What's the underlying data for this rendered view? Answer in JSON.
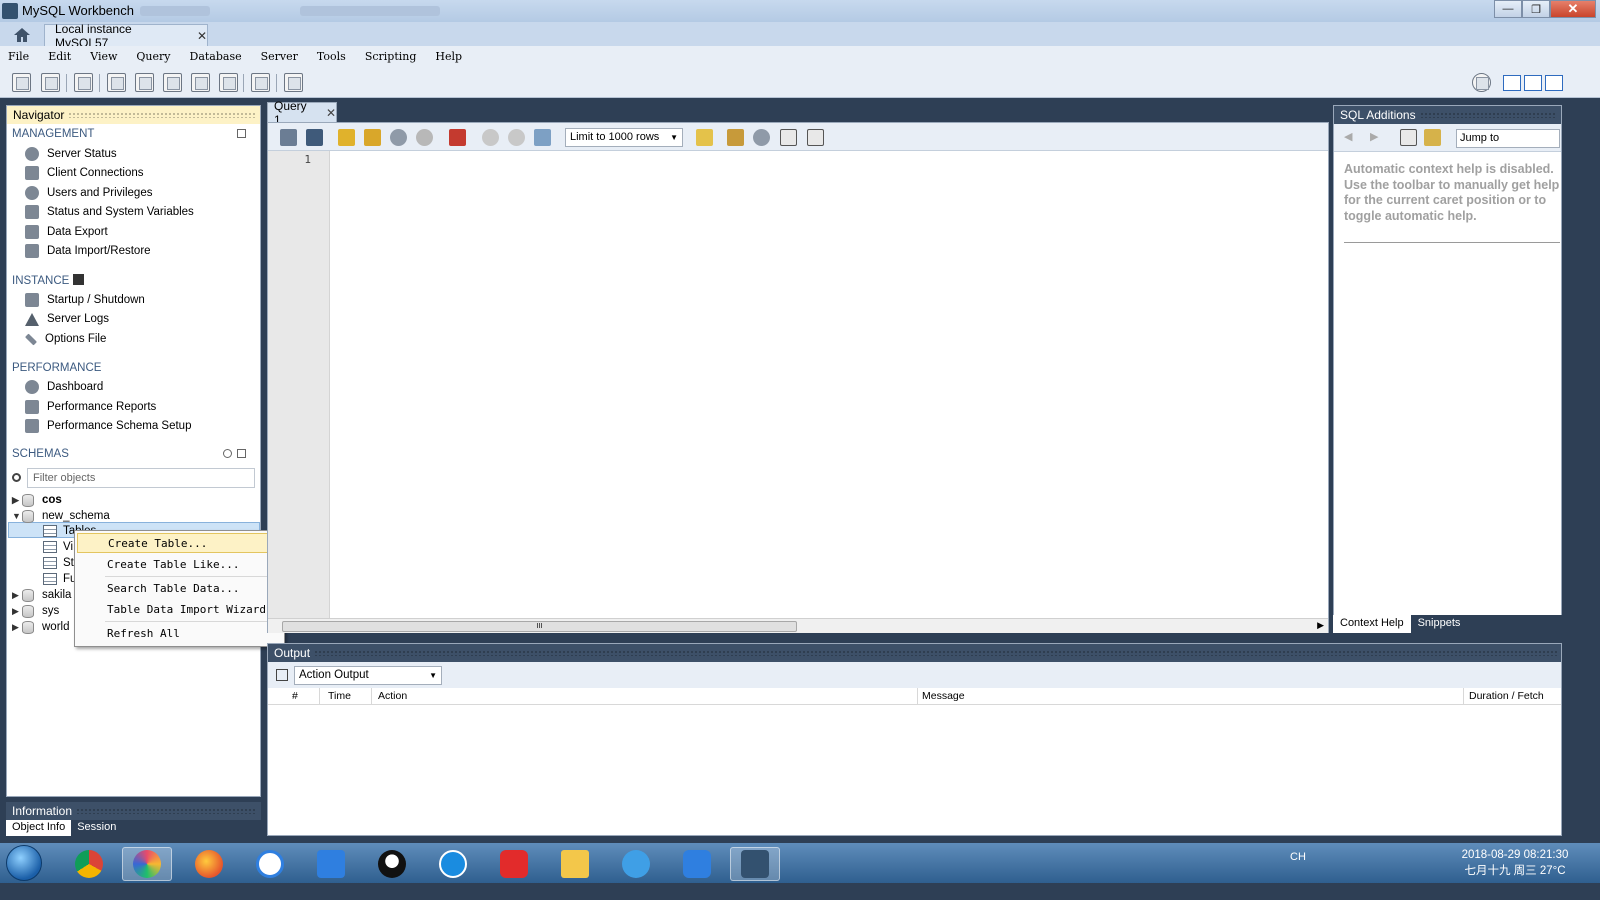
{
  "window": {
    "title": "MySQL Workbench",
    "connection_tab": "Local instance MySQL57"
  },
  "menu": [
    "File",
    "Edit",
    "View",
    "Query",
    "Database",
    "Server",
    "Tools",
    "Scripting",
    "Help"
  ],
  "navigator": {
    "header": "Navigator",
    "management": {
      "title": "MANAGEMENT",
      "items": [
        {
          "label": "Server Status",
          "icon": "server-status-icon"
        },
        {
          "label": "Client Connections",
          "icon": "client-connections-icon"
        },
        {
          "label": "Users and Privileges",
          "icon": "users-icon"
        },
        {
          "label": "Status and System Variables",
          "icon": "variables-icon"
        },
        {
          "label": "Data Export",
          "icon": "export-icon"
        },
        {
          "label": "Data Import/Restore",
          "icon": "import-icon"
        }
      ]
    },
    "instance": {
      "title": "INSTANCE",
      "items": [
        {
          "label": "Startup / Shutdown",
          "icon": "startup-icon"
        },
        {
          "label": "Server Logs",
          "icon": "warning-icon"
        },
        {
          "label": "Options File",
          "icon": "wrench-icon"
        }
      ]
    },
    "performance": {
      "title": "PERFORMANCE",
      "items": [
        {
          "label": "Dashboard",
          "icon": "dashboard-icon"
        },
        {
          "label": "Performance Reports",
          "icon": "reports-icon"
        },
        {
          "label": "Performance Schema Setup",
          "icon": "schema-setup-icon"
        }
      ]
    },
    "schemas": {
      "title": "SCHEMAS",
      "filter_placeholder": "Filter objects",
      "tree": [
        {
          "label": "cos",
          "bold": true,
          "expanded": false
        },
        {
          "label": "new_schema",
          "expanded": true
        },
        {
          "label": "Tables",
          "child": true
        },
        {
          "label": "Vi",
          "child": true
        },
        {
          "label": "St",
          "child": true
        },
        {
          "label": "Fu",
          "child": true
        },
        {
          "label": "sakila",
          "expanded": false
        },
        {
          "label": "sys",
          "expanded": false
        },
        {
          "label": "world",
          "expanded": false
        }
      ]
    }
  },
  "context_menu": {
    "items": [
      "Create Table...",
      "Create Table Like...",
      "Search Table Data...",
      "Table Data Import Wizard",
      "Refresh All"
    ]
  },
  "information": {
    "header": "Information",
    "tabs": [
      "Object Info",
      "Session"
    ]
  },
  "query": {
    "tab_label": "Query 1",
    "limit_label": "Limit to 1000 rows",
    "line_number": "1",
    "scroll_grip": "III"
  },
  "sql_additions": {
    "header": "SQL Additions",
    "jump_to": "Jump to",
    "help_text": "Automatic context help is disabled. Use the toolbar to manually get help for the current caret position or to toggle automatic help.",
    "tabs": [
      "Context Help",
      "Snippets"
    ]
  },
  "output": {
    "header": "Output",
    "selector": "Action Output",
    "columns": [
      "#",
      "Time",
      "Action",
      "Message",
      "Duration / Fetch"
    ]
  },
  "taskbar": {
    "tray_text": "CH",
    "clock_line1": "2018-08-29  08:21:30",
    "clock_line2": "七月十九 周三 27°C"
  }
}
